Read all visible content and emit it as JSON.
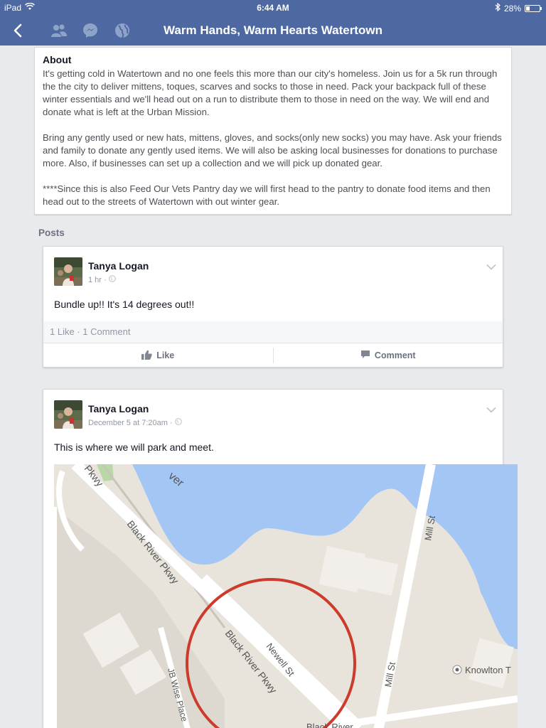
{
  "status_bar": {
    "device": "iPad",
    "time": "6:44 AM",
    "battery": "28%",
    "battery_level": 0.28
  },
  "nav": {
    "title": "Warm Hands, Warm Hearts Watertown"
  },
  "about": {
    "heading": "About",
    "paragraphs": [
      "It's getting cold in Watertown and no one feels this more than our city's homeless. Join us for a 5k run through the the city to deliver mittens, toques, scarves and socks to those in need. Pack your backpack full of these winter essentials and we'll head out on a run to distribute them to those in need on the way. We will end and donate what is left at the Urban Mission.",
      "Bring any gently used or new hats, mittens, gloves, and socks(only new socks) you may have. Ask your friends and family to donate any gently used items. We will also be asking local businesses for donations to purchase more. Also, if businesses can set up a collection and we will pick up donated gear.",
      "****Since this is also Feed Our Vets Pantry day we will first head to the pantry to donate food items and then head out to the streets of Watertown with out winter gear."
    ]
  },
  "posts_label": "Posts",
  "posts": [
    {
      "author": "Tanya Logan",
      "time": "1 hr ·",
      "text": "Bundle up!! It's 14 degrees out!!",
      "stats": "1 Like · 1 Comment",
      "like_label": "Like",
      "comment_label": "Comment"
    },
    {
      "author": "Tanya Logan",
      "time": "December 5 at 7:20am ·",
      "text": "This is where we will park and meet.",
      "map": {
        "labels": {
          "river": "ver",
          "pkwy_top": "Pkwy",
          "black_river_1": "Black River Pkwy",
          "black_river_2": "Black River Pkwy",
          "newell": "Newell St",
          "mill_1": "Mill St",
          "mill_2": "Mill St",
          "jb_wise": "JB Wise Place",
          "knowlton": "Knowlton T",
          "black_river_bottom": "Black River"
        }
      }
    }
  ],
  "colors": {
    "header": "#4e69a2",
    "background": "#e9eaed",
    "water": "#a3c6f5",
    "circle": "#cc3b2b"
  }
}
